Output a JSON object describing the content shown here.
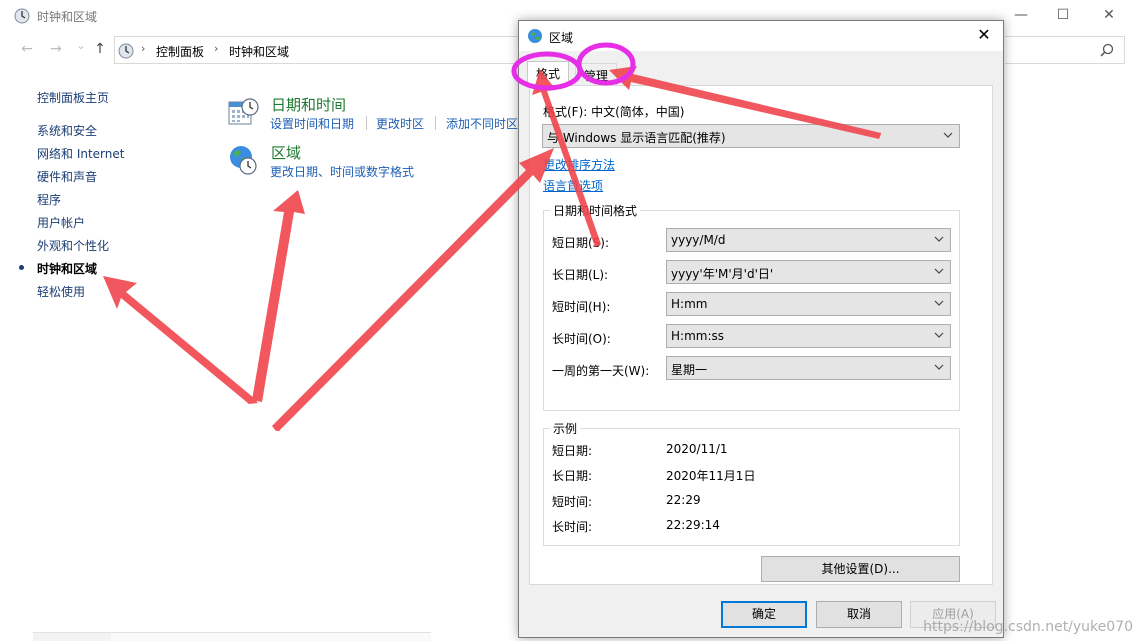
{
  "window": {
    "title": "时钟和区域",
    "controls": {
      "minimize": "—",
      "maximize": "☐",
      "close": "✕"
    }
  },
  "nav": {
    "back": "←",
    "forward": "→",
    "recent": "⌄",
    "up": "↑"
  },
  "address": {
    "crumbs": [
      "控制面板",
      "时钟和区域"
    ],
    "separator": "›"
  },
  "sidebar": {
    "items": [
      {
        "label": "控制面板主页",
        "active": false
      },
      {
        "label": "系统和安全",
        "active": false
      },
      {
        "label": "网络和 Internet",
        "active": false
      },
      {
        "label": "硬件和声音",
        "active": false
      },
      {
        "label": "程序",
        "active": false
      },
      {
        "label": "用户帐户",
        "active": false
      },
      {
        "label": "外观和个性化",
        "active": false
      },
      {
        "label": "时钟和区域",
        "active": true
      },
      {
        "label": "轻松使用",
        "active": false
      }
    ]
  },
  "categories": [
    {
      "title": "日期和时间",
      "icon": "calendar-clock-icon",
      "links": [
        "设置时间和日期",
        "更改时区",
        "添加不同时区"
      ]
    },
    {
      "title": "区域",
      "icon": "globe-clock-icon",
      "links": [
        "更改日期、时间或数字格式"
      ]
    }
  ],
  "dialog": {
    "title": "区域",
    "close": "✕",
    "tabs": [
      {
        "label": "格式",
        "active": true
      },
      {
        "label": "管理",
        "active": false
      }
    ],
    "format_label": "格式(F): 中文(简体，中国)",
    "format_value": "与 Windows 显示语言匹配(推荐)",
    "links": [
      "更改排序方法",
      "语言首选项"
    ],
    "datetime_group": {
      "title": "日期和时间格式",
      "rows": [
        {
          "label": "短日期(S):",
          "value": "yyyy/M/d"
        },
        {
          "label": "长日期(L):",
          "value": "yyyy'年'M'月'd'日'"
        },
        {
          "label": "短时间(H):",
          "value": "H:mm"
        },
        {
          "label": "长时间(O):",
          "value": "H:mm:ss"
        },
        {
          "label": "一周的第一天(W):",
          "value": "星期一"
        }
      ]
    },
    "example_group": {
      "title": "示例",
      "rows": [
        {
          "label": "短日期:",
          "value": "2020/11/1"
        },
        {
          "label": "长日期:",
          "value": "2020年11月1日"
        },
        {
          "label": "短时间:",
          "value": "22:29"
        },
        {
          "label": "长时间:",
          "value": "22:29:14"
        }
      ]
    },
    "other_settings": "其他设置(D)...",
    "buttons": {
      "ok": "确定",
      "cancel": "取消",
      "apply": "应用(A)"
    }
  },
  "colors": {
    "annotation_arrow": "#f0454c",
    "annotation_circle": "#e62ee6",
    "link_blue": "#1e5fb4",
    "category_green": "#1e7a2e",
    "default_button_border": "#0078d7"
  },
  "watermark": "https://blog.csdn.net/yuke070"
}
